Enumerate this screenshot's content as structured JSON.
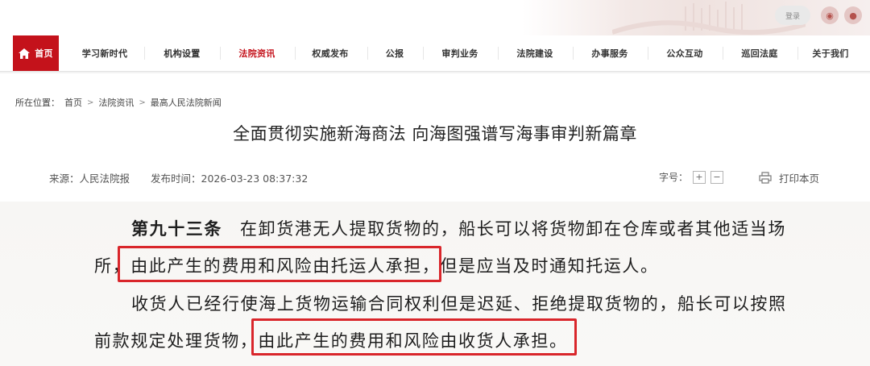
{
  "header": {
    "login_label": "登录",
    "icons": [
      "weibo-icon",
      "wechat-icon",
      "app-icon"
    ]
  },
  "nav": {
    "home_label": "首页",
    "items": [
      {
        "label": "学习新时代"
      },
      {
        "label": "机构设置"
      },
      {
        "label": "法院资讯",
        "active": true
      },
      {
        "label": "权威发布"
      },
      {
        "label": "公报"
      },
      {
        "label": "审判业务"
      },
      {
        "label": "法院建设"
      },
      {
        "label": "办事服务"
      },
      {
        "label": "公众互动"
      },
      {
        "label": "巡回法庭"
      },
      {
        "label": "关于我们"
      }
    ],
    "accent_color": "#c4121b"
  },
  "breadcrumb": {
    "prefix": "所在位置：",
    "items": [
      "首页",
      "法院资讯",
      "最高人民法院新闻"
    ]
  },
  "article": {
    "title": "全面贯彻实施新海商法 向海图强谱写海事审判新篇章",
    "source": "来源：人民法院报",
    "publish_time": "发布时间：2026-03-23 08:37:32",
    "font_size_label": "字号：",
    "font_plus": "+",
    "font_minus": "−",
    "print_label": "打印本页"
  },
  "excerpt": {
    "line1_article": "第九十三条",
    "line1_text": "在卸货港无人提取货物的，船长可以将货物卸在仓库或者其他适当场",
    "line2_prefix": "所，",
    "line2_highlight": "由此产生的费用和风险由托运人承担，",
    "line2_suffix": "但是应当及时通知托运人。",
    "line3_text": "收货人已经行使海上货物运输合同权利但是迟延、拒绝提取货物的，船长可以按照",
    "line4_prefix": "前款规定处理货物，",
    "line4_highlight": "由此产生的费用和风险由收货人承担。",
    "highlight_color": "#d9262b"
  }
}
